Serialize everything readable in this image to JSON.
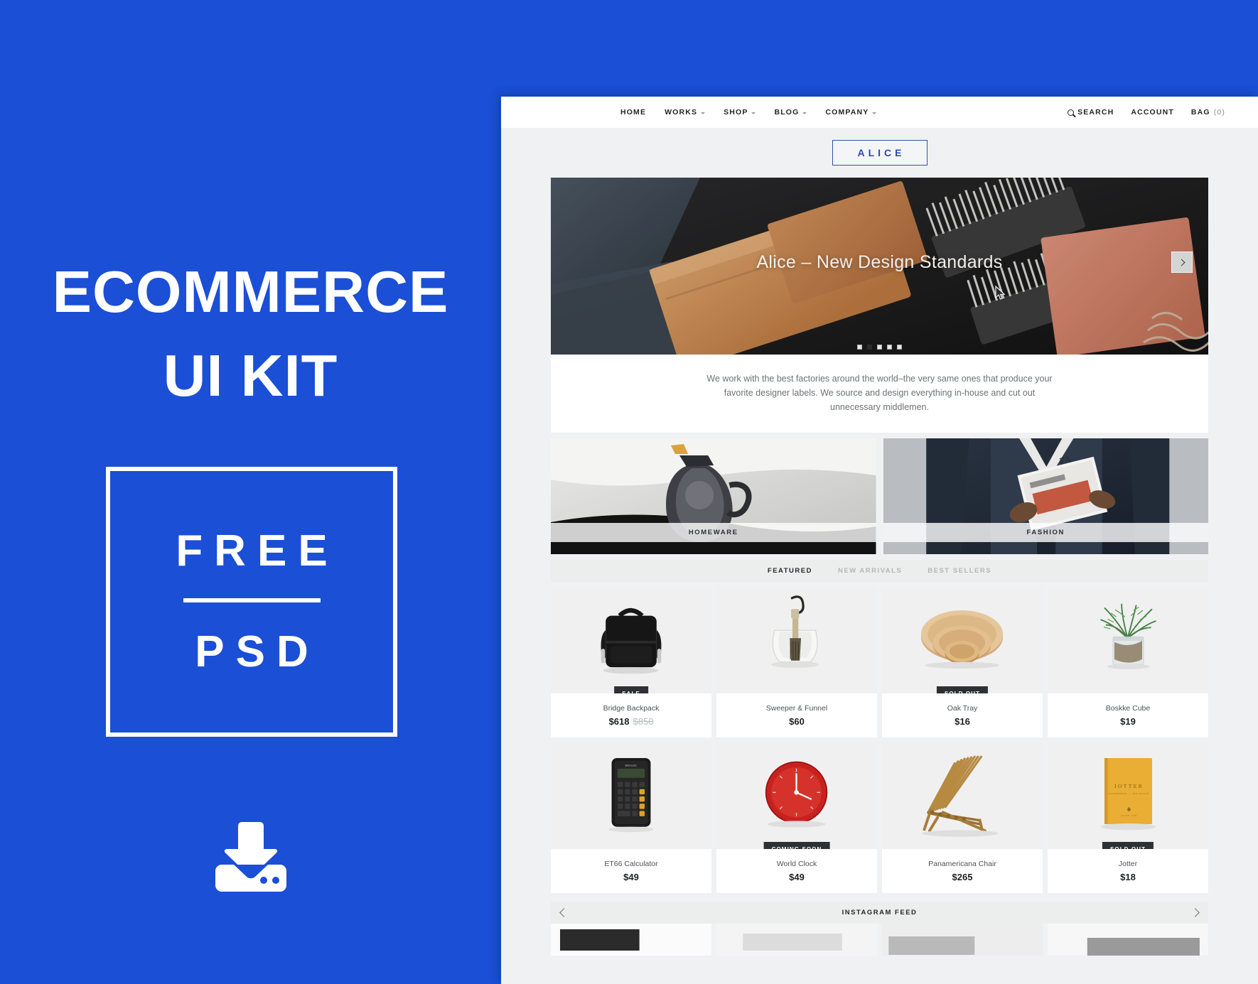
{
  "promo": {
    "title_line1": "ECOMMERCE",
    "title_line2": "UI KIT",
    "free_label": "FREE",
    "psd_label": "PSD",
    "download_icon": "download-icon",
    "brand_color": "#1a4fd6",
    "text_color": "#ffffff"
  },
  "site": {
    "nav": [
      {
        "label": "HOME",
        "has_caret": false
      },
      {
        "label": "WORKS",
        "has_caret": true
      },
      {
        "label": "SHOP",
        "has_caret": true
      },
      {
        "label": "BLOG",
        "has_caret": true
      },
      {
        "label": "COMPANY",
        "has_caret": true
      }
    ],
    "utility": {
      "search_label": "SEARCH",
      "search_icon": "search-icon",
      "account_label": "ACCOUNT",
      "bag_label": "BAG",
      "bag_count": "(0)"
    },
    "logo": "ALICE",
    "logo_border_color": "#3252a8",
    "logo_text_color": "#2a49b8",
    "hero": {
      "title": "Alice – New Design Standards",
      "next_icon": "chevron-right-icon",
      "dots": 5,
      "active_dot": 1
    },
    "intro": "We work with the best factories around the world–the very same ones that produce your favorite designer labels. We source and design everything in-house and cut out unnecessary middlemen.",
    "categories": [
      {
        "label": "HOMEWARE"
      },
      {
        "label": "FASHION"
      }
    ],
    "product_tabs": [
      {
        "label": "FEATURED",
        "active": true
      },
      {
        "label": "NEW ARRIVALS",
        "active": false
      },
      {
        "label": "BEST SELLERS",
        "active": false
      }
    ],
    "products": [
      {
        "name": "Bridge Backpack",
        "price": "$618",
        "old_price": "$850",
        "badge": "SALE"
      },
      {
        "name": "Sweeper & Funnel",
        "price": "$60",
        "old_price": "",
        "badge": ""
      },
      {
        "name": "Oak Tray",
        "price": "$16",
        "old_price": "",
        "badge": "SOLD OUT"
      },
      {
        "name": "Boskke Cube",
        "price": "$19",
        "old_price": "",
        "badge": ""
      },
      {
        "name": "ET66 Calculator",
        "price": "$49",
        "old_price": "",
        "badge": ""
      },
      {
        "name": "World Clock",
        "price": "$49",
        "old_price": "",
        "badge": "COMING SOON"
      },
      {
        "name": "Panamericana Chair",
        "price": "$265",
        "old_price": "",
        "badge": ""
      },
      {
        "name": "Jotter",
        "price": "$18",
        "old_price": "",
        "badge": "SOLD OUT"
      }
    ],
    "instagram": {
      "title": "INSTAGRAM FEED",
      "prev_icon": "chevron-left-icon",
      "next_icon": "chevron-right-icon"
    }
  }
}
